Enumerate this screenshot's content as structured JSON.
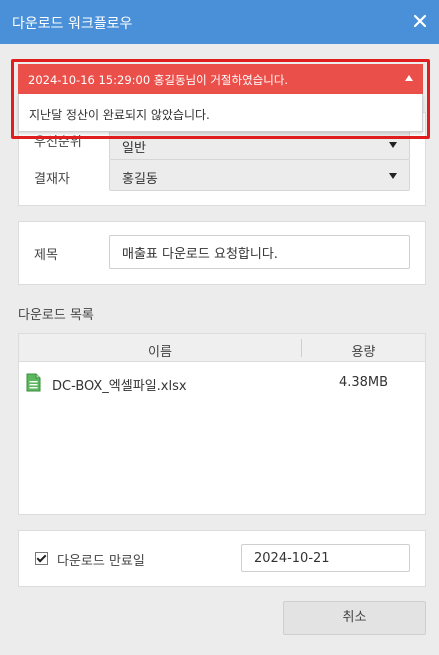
{
  "window": {
    "title": "다운로드 워크플로우"
  },
  "approval": {
    "priority_label": "우선순위",
    "priority_value": "일반",
    "approver_label": "결재자",
    "approver_value": "홍길동"
  },
  "subject": {
    "label": "제목",
    "value": "매출표 다운로드 요청합니다."
  },
  "files": {
    "section_title": "다운로드 목록",
    "columns": {
      "name": "이름",
      "size": "용량"
    },
    "items": [
      {
        "name": "DC-BOX_엑셀파일.xlsx",
        "size": "4.38MB",
        "icon": "excel-file-icon"
      }
    ]
  },
  "expiry": {
    "checked": true,
    "label": "다운로드 만료일",
    "date": "2024-10-21"
  },
  "actions": {
    "cancel_label": "취소"
  },
  "notification": {
    "header": "2024-10-16 15:29:00 홍길동님이 거절하였습니다.",
    "message": "지난달 정산이 완료되지 않았습니다.",
    "color": "#ea4f4a",
    "frame_color": "#e01e1e"
  },
  "colors": {
    "titlebar": "#4a90d9",
    "excel_green": "#4caf50"
  }
}
